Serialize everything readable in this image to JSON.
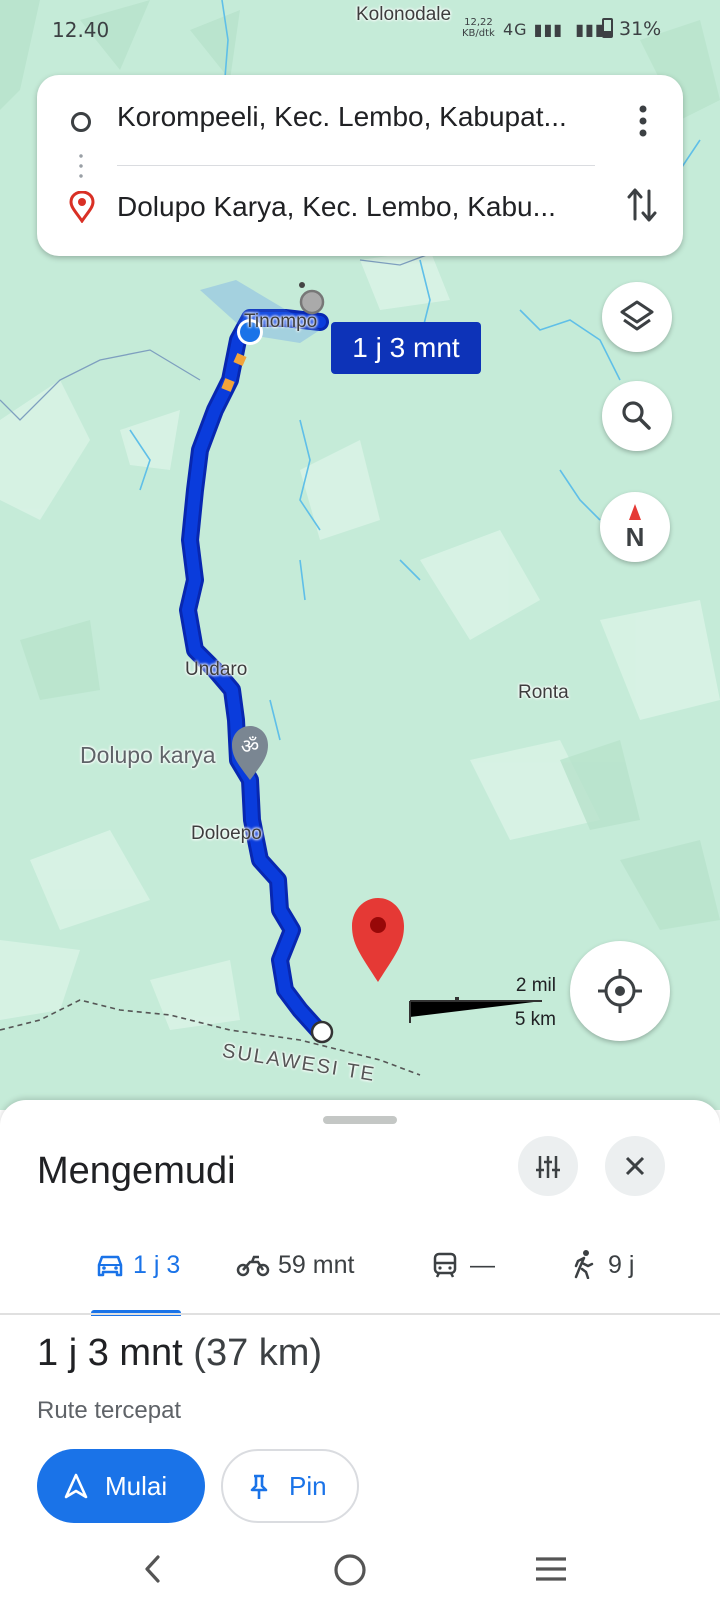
{
  "status_bar": {
    "time": "12.40",
    "net_speed_value": "12,22",
    "net_speed_unit": "KB/dtk",
    "network": "4G",
    "battery": "31%"
  },
  "directions": {
    "origin": "Korompeeli, Kec. Lembo, Kabupat...",
    "destination": "Dolupo Karya, Kec. Lembo, Kabu..."
  },
  "map": {
    "route_time_label": "1 j 3 mnt",
    "places": {
      "kolonodale": "Kolonodale",
      "tinompo": "Tinompo",
      "undaro": "Undaro",
      "ronta": "Ronta",
      "dolupo_karya": "Dolupo karya",
      "doloepo": "Doloepo",
      "province": "SULAWESI TE"
    },
    "compass_letter": "N",
    "scale": {
      "imperial": "2 mil",
      "metric": "5 km"
    },
    "colors": {
      "route": "#0a3cdc",
      "map_bg": "#c5ebd8",
      "water": "#5fbfe8",
      "pin": "#e53935"
    }
  },
  "sheet": {
    "title": "Mengemudi",
    "modes": [
      {
        "icon": "car-icon",
        "label": "1 j 3"
      },
      {
        "icon": "motorcycle-icon",
        "label": "59 mnt"
      },
      {
        "icon": "transit-icon",
        "label": "—"
      },
      {
        "icon": "walk-icon",
        "label": "9 j"
      }
    ],
    "summary_time": "1 j 3 mnt",
    "summary_distance": "(37 km)",
    "summary_sub": "Rute tercepat",
    "start_label": "Mulai",
    "pin_label": "Pin"
  }
}
